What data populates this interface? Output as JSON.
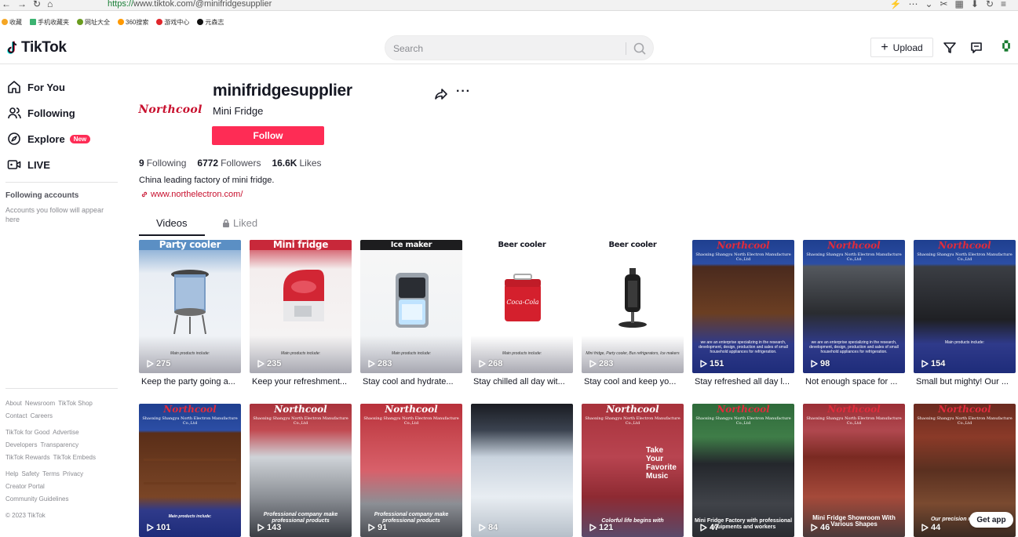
{
  "browser": {
    "url_scheme": "https://",
    "url_host": "www.tiktok.com",
    "url_path": "/@minifridgesupplier",
    "bookmarks": [
      "收藏",
      "手机收藏夹",
      "网址大全",
      "360搜索",
      "游戏中心",
      "元森志"
    ]
  },
  "header": {
    "logo_text": "TikTok",
    "search_placeholder": "Search",
    "upload_label": "Upload"
  },
  "sidebar": {
    "nav": [
      {
        "label": "For You",
        "icon": "home-icon"
      },
      {
        "label": "Following",
        "icon": "people-icon"
      },
      {
        "label": "Explore",
        "icon": "compass-icon",
        "badge": "New"
      },
      {
        "label": "LIVE",
        "icon": "live-icon"
      }
    ],
    "following_title": "Following accounts",
    "following_desc": "Accounts you follow will appear here",
    "footer": [
      [
        "About",
        "Newsroom",
        "TikTok Shop"
      ],
      [
        "Contact",
        "Careers"
      ],
      [
        "TikTok for Good",
        "Advertise"
      ],
      [
        "Developers",
        "Transparency"
      ],
      [
        "TikTok Rewards",
        "TikTok Embeds"
      ],
      [
        "Help",
        "Safety",
        "Terms",
        "Privacy"
      ],
      [
        "Creator Portal"
      ],
      [
        "Community Guidelines"
      ],
      [
        "© 2023 TikTok"
      ]
    ]
  },
  "profile": {
    "avatar_text": "Northcool",
    "username": "minifridgesupplier",
    "nickname": "Mini Fridge",
    "follow_label": "Follow",
    "following_count": "9",
    "following_label": "Following",
    "followers_count": "6772",
    "followers_label": "Followers",
    "likes_count": "16.6K",
    "likes_label": "Likes",
    "bio": "China leading factory of mini fridge.",
    "link": "www.northelectron.com/"
  },
  "tabs": {
    "videos": "Videos",
    "liked": "Liked"
  },
  "videos_row1": [
    {
      "title": "Party cooler",
      "views": "275",
      "caption": "Keep the party going a...",
      "bg": "#5b8fc4"
    },
    {
      "title": "Mini fridge",
      "views": "235",
      "caption": "Keep your refreshment...",
      "bg": "#c8283a"
    },
    {
      "title": "Ice maker",
      "views": "283",
      "caption": "Stay cool and hydrate...",
      "bg": "#1d1d1f"
    },
    {
      "title": "Beer cooler",
      "views": "268",
      "caption": "Stay chilled all day wit...",
      "bg": "#ffffff"
    },
    {
      "title": "Beer cooler",
      "views": "283",
      "caption": "Stay cool and keep yo...",
      "bg": "#ffffff"
    },
    {
      "views": "151",
      "caption": "Stay refreshed all day l..."
    },
    {
      "views": "98",
      "caption": "Not enough space for ..."
    },
    {
      "views": "154",
      "caption": "Small but mighty! Our ..."
    }
  ],
  "videos_row2": [
    {
      "views": "101",
      "overlay": "Main products include:"
    },
    {
      "views": "143",
      "overlay": "Professional company make professional products"
    },
    {
      "views": "91",
      "overlay": "Professional company make professional products"
    },
    {
      "views": "84",
      "overlay": ""
    },
    {
      "views": "121",
      "overlay": "Colorful life begins with"
    },
    {
      "views": "47",
      "overlay": "Mini Fridge Factory with professional equipments and workers"
    },
    {
      "views": "46",
      "overlay": "Mini Fridge Showroom With Various Shapes"
    },
    {
      "views": "44",
      "overlay": "Our precision manufacturing"
    }
  ],
  "banner": {
    "brand": "Northcool",
    "company": "Shaoxing Shangyu North Electron Manufacture Co.,Ltd",
    "intro": "we are an enterprise specializing in the research, development, design, production and sales of small household appliances for refrigeration.",
    "main_products": "Main products include:",
    "products_list": "Mini fridge, Party cooler, Bus refrigerators, Ice makers",
    "take_music": "Take Your Favorite Music"
  },
  "get_app": "Get app"
}
